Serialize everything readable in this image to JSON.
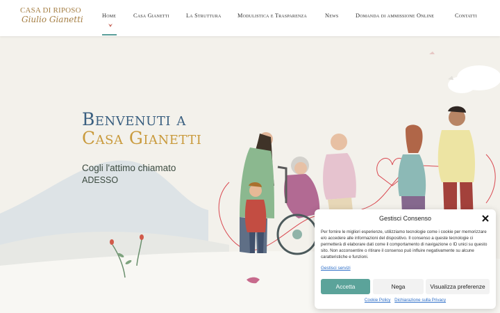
{
  "logo": {
    "line1": "CASA DI RIPOSO",
    "line2": "Giulio Gianetti"
  },
  "nav": {
    "items": [
      {
        "label": "Home"
      },
      {
        "label": "Casa Gianetti"
      },
      {
        "label": "La Struttura"
      },
      {
        "label": "Modulistica e Trasparenza"
      },
      {
        "label": "News"
      },
      {
        "label": "Domanda di ammissione Online"
      },
      {
        "label": "Contatti"
      }
    ],
    "active_index": 0
  },
  "hero": {
    "title_line1": "Benvenuti a",
    "title_line2": "Casa Gianetti",
    "subtitle": "Cogli l'attimo chiamato",
    "subtitle2": "ADESSO"
  },
  "cookie": {
    "title": "Gestisci Consenso",
    "body": "Per fornire le migliori esperienze, utilizziamo tecnologie come i cookie per memorizzare e/o accedere alle informazioni del dispositivo. Il consenso a queste tecnologie ci permetterà di elaborare dati come il comportamento di navigazione o ID unici su questo sito. Non acconsentire o ritirare il consenso può influire negativamente su alcune caratteristiche e funzioni.",
    "manage_services": "Gestisci servizi",
    "accept": "Accetta",
    "deny": "Nega",
    "preferences": "Visualizza preferenze",
    "cookie_policy": "Cookie Policy",
    "privacy": "Dichiarazione sulla Privacy"
  },
  "colors": {
    "brand_gold": "#a57e43",
    "accent_teal": "#5ba39a",
    "title_blue": "#3a5f80",
    "title_gold": "#c99a3c",
    "title_red": "#c05a4a",
    "title_green": "#5e8a5e"
  },
  "icons": {
    "close": "close-icon",
    "active_marker": "leaf-icon"
  }
}
